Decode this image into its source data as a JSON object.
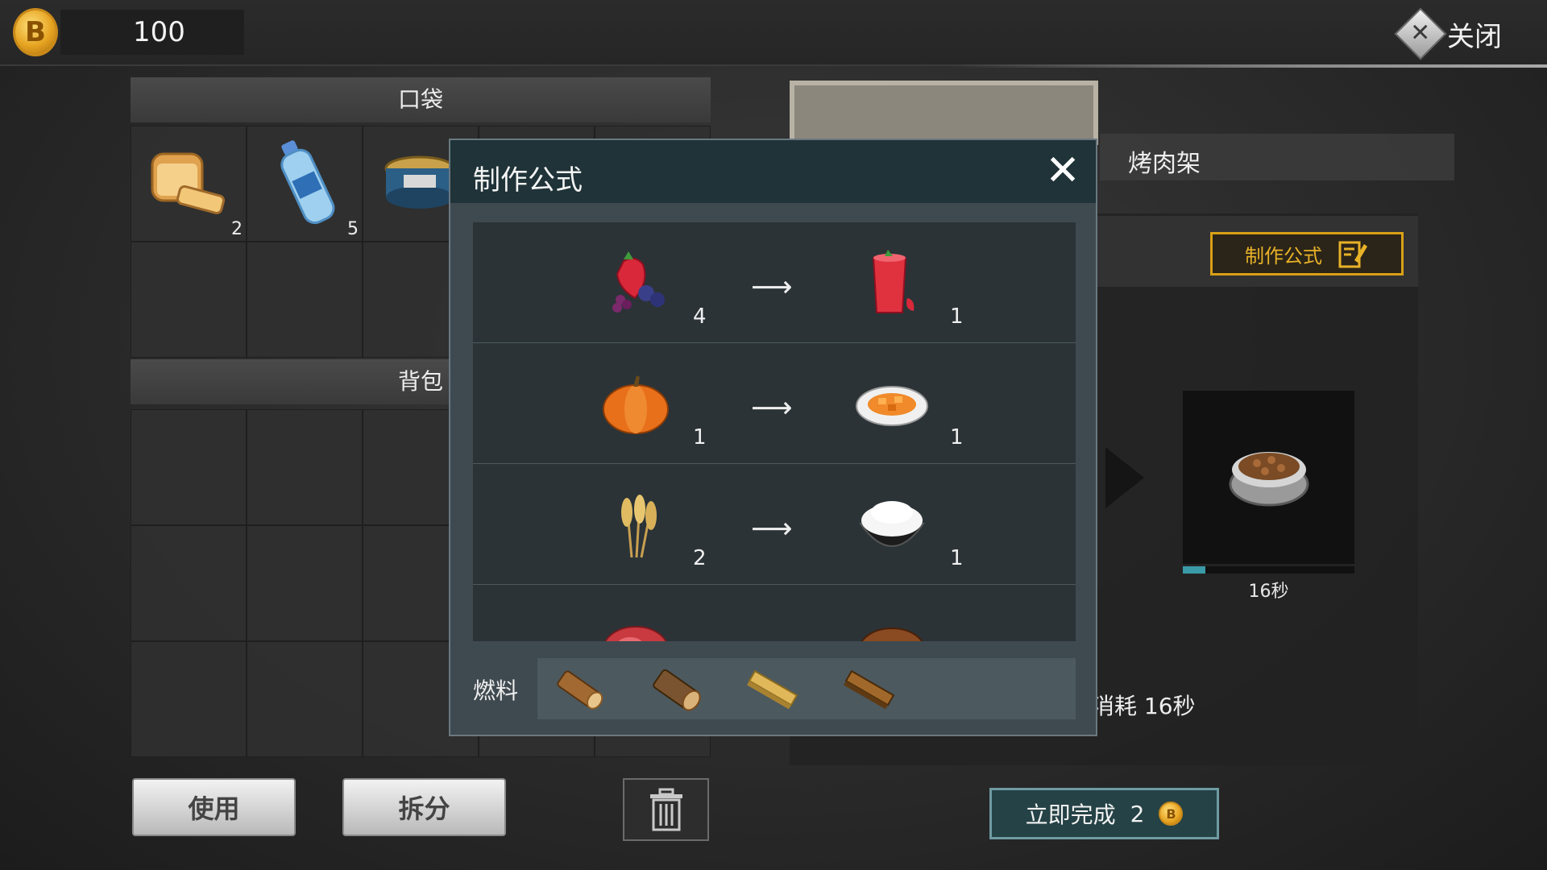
{
  "top_bar": {
    "coin_symbol": "B",
    "coin_count": "100",
    "close_label": "关闭"
  },
  "pocket": {
    "title": "口袋",
    "items": [
      {
        "icon": "bread-icon",
        "qty": "2"
      },
      {
        "icon": "water-bottle-icon",
        "qty": "5"
      },
      {
        "icon": "canned-fish-icon",
        "qty": ""
      }
    ]
  },
  "backpack": {
    "title": "背包"
  },
  "station": {
    "title": "烤肉架",
    "formula_button": "制作公式",
    "output_time": "16秒",
    "progress": 0.13,
    "consume_text": "消耗 16秒",
    "finish_label": "立即完成",
    "finish_cost": "2"
  },
  "modal": {
    "title": "制作公式",
    "close": "✕",
    "recipes": [
      {
        "input_icon": "berries-icon",
        "input_qty": "4",
        "arrow": "⟶",
        "output_icon": "berry-juice-icon",
        "output_qty": "1"
      },
      {
        "input_icon": "pumpkin-icon",
        "input_qty": "1",
        "arrow": "⟶",
        "output_icon": "pumpkin-dish-icon",
        "output_qty": "1"
      },
      {
        "input_icon": "wheat-icon",
        "input_qty": "2",
        "arrow": "⟶",
        "output_icon": "rice-bowl-icon",
        "output_qty": "1"
      },
      {
        "input_icon": "raw-meat-icon",
        "input_qty": "",
        "arrow": "",
        "output_icon": "cooked-meat-icon",
        "output_qty": ""
      }
    ],
    "fuel_label": "燃料",
    "fuels": [
      "log-icon",
      "log-icon",
      "plank-icon",
      "dark-plank-icon"
    ]
  },
  "buttons": {
    "use": "使用",
    "split": "拆分"
  },
  "colors": {
    "accent_gold": "#d9a017",
    "modal_header": "#1f3338",
    "progress": "#3a9aa8"
  }
}
